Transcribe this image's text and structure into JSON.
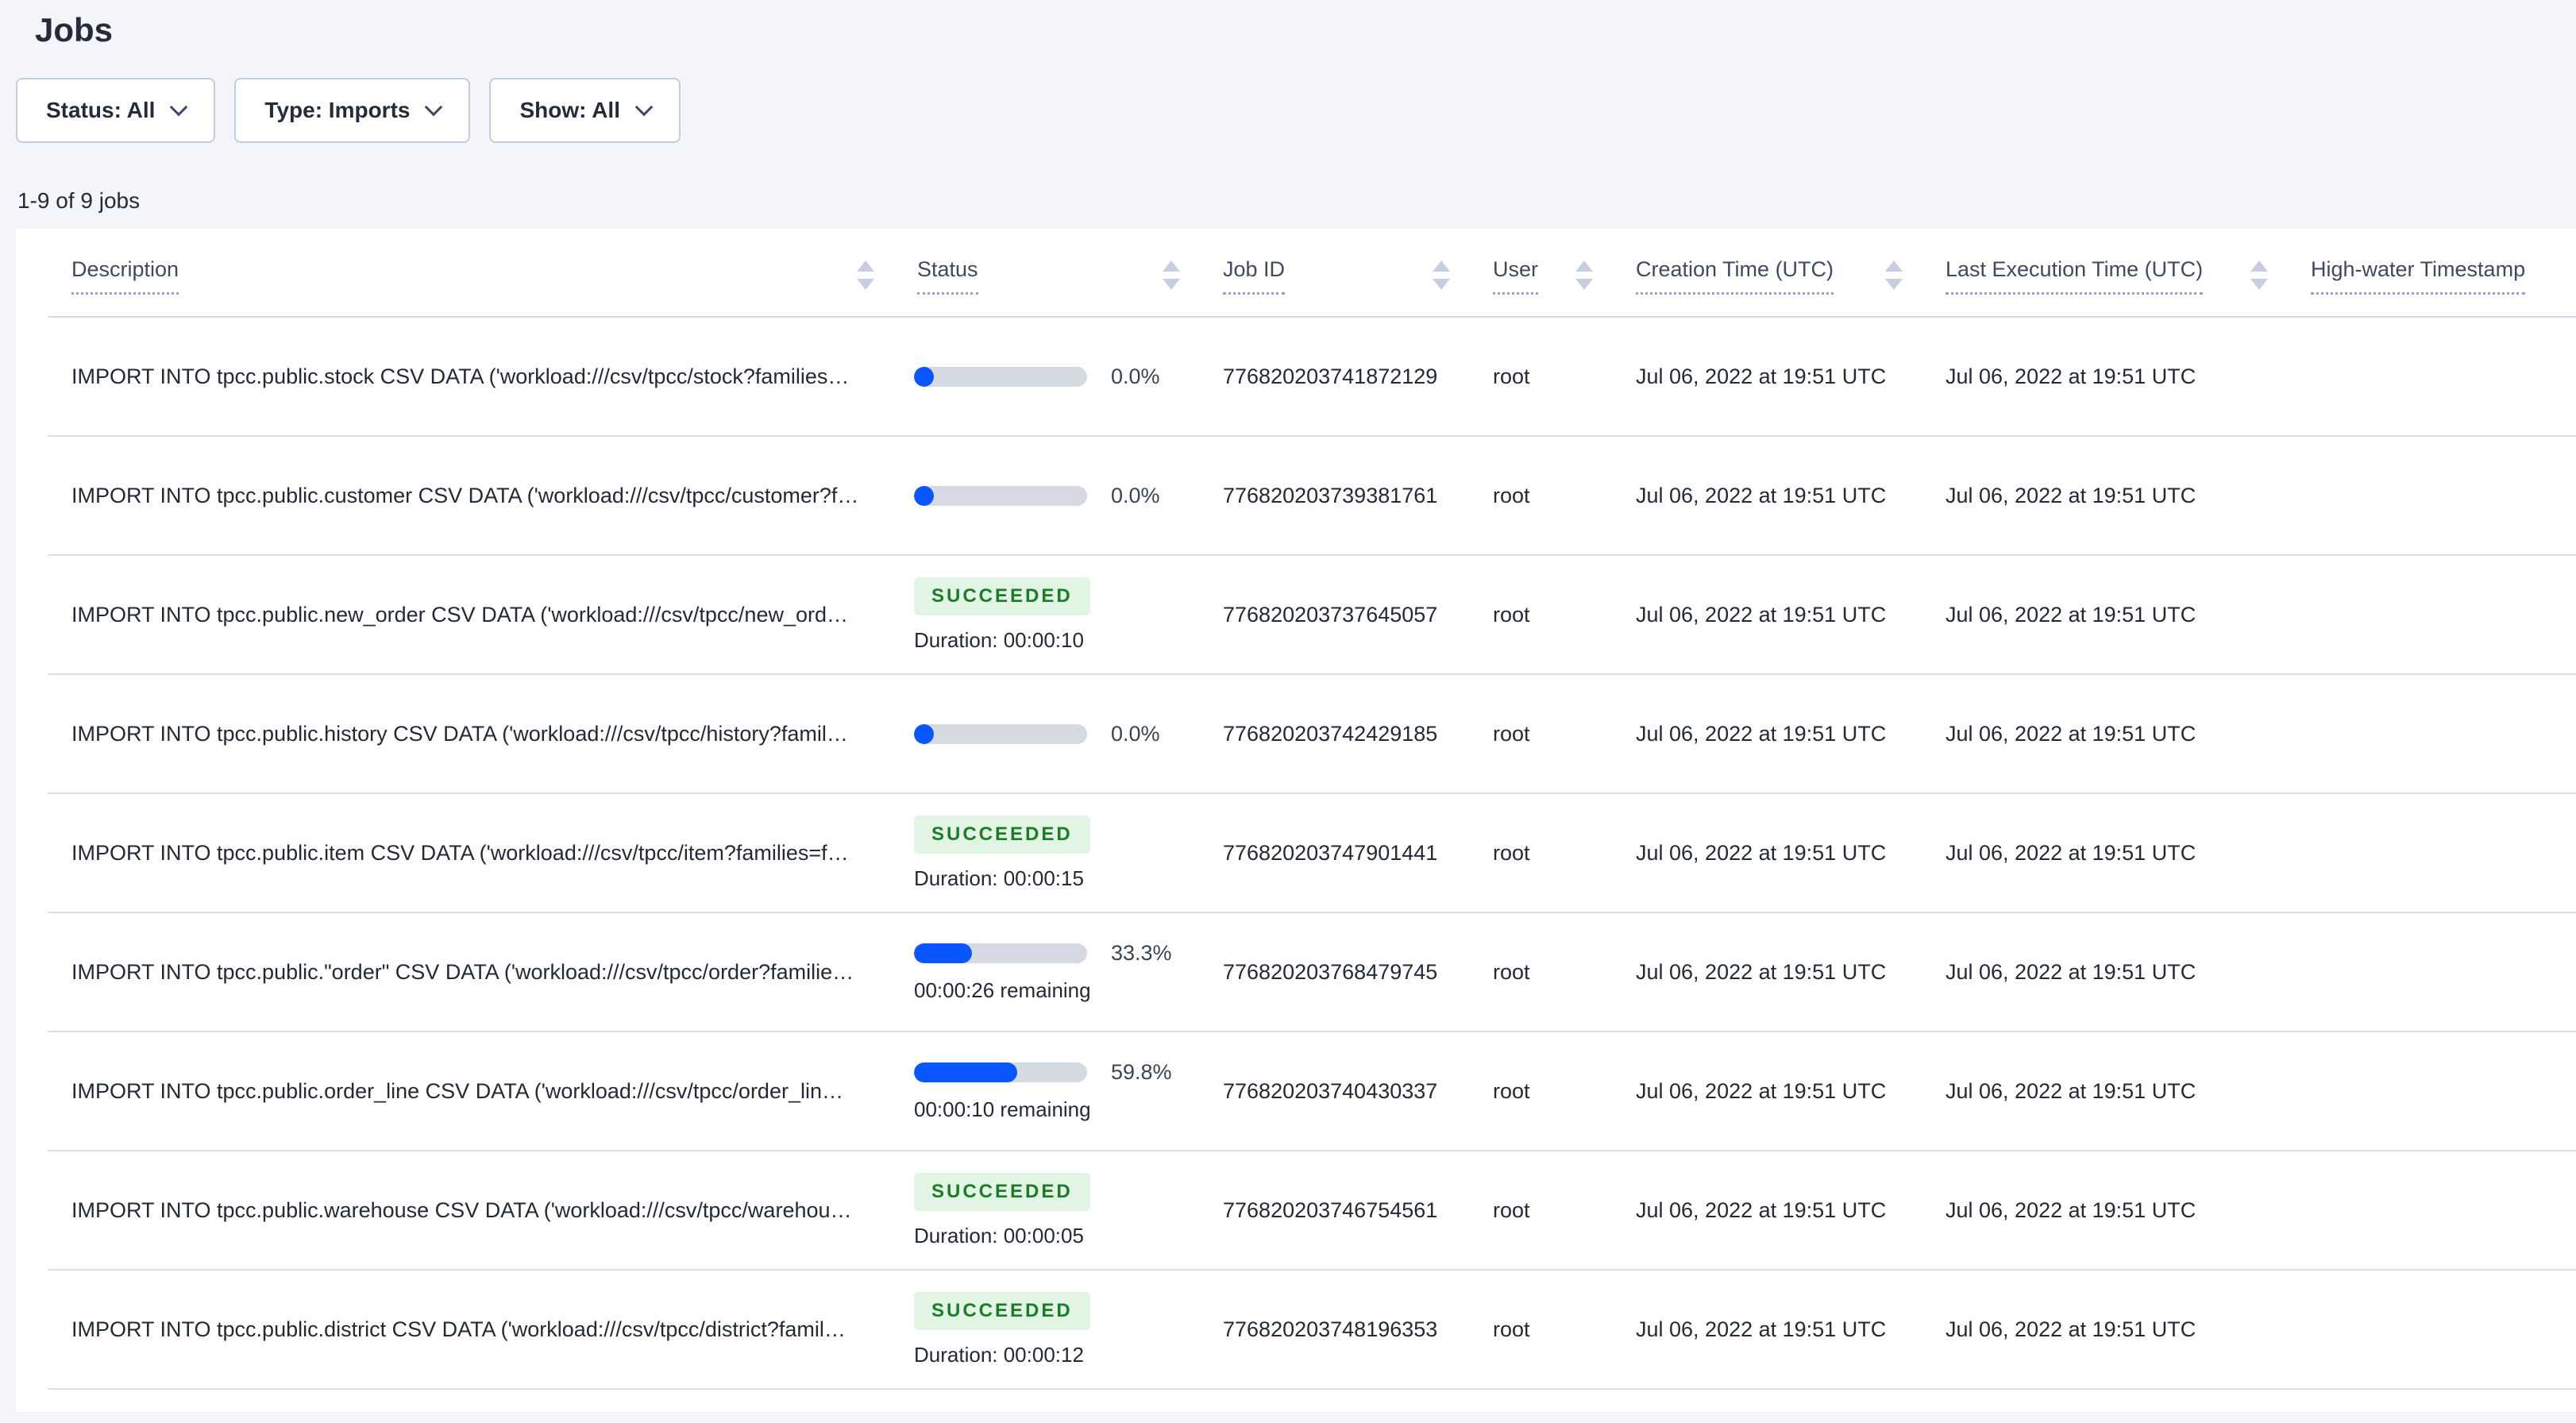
{
  "page": {
    "title": "Jobs"
  },
  "filters": [
    {
      "label": "Status: All"
    },
    {
      "label": "Type: Imports"
    },
    {
      "label": "Show: All"
    }
  ],
  "results_count": "1-9 of 9 jobs",
  "colors": {
    "accent_blue": "#0a57ff",
    "progress_track": "#d5d9e2",
    "success_badge_bg": "#e2f4e4",
    "success_badge_text": "#1d7c29"
  },
  "table": {
    "columns": [
      {
        "label": "Description",
        "sort": "none"
      },
      {
        "label": "Status",
        "sort": "none"
      },
      {
        "label": "Job ID",
        "sort": "none"
      },
      {
        "label": "User",
        "sort": "none"
      },
      {
        "label": "Creation Time (UTC)",
        "sort": "none"
      },
      {
        "label": "Last Execution Time (UTC)",
        "sort": "none"
      },
      {
        "label": "High-water Timestamp",
        "sort": "desc"
      }
    ],
    "rows": [
      {
        "description": "IMPORT INTO tpcc.public.stock CSV DATA ('workload:///csv/tpcc/stock?families…",
        "status": {
          "kind": "progress",
          "percent": 0,
          "percent_label": "0.0%"
        },
        "job_id": "776820203741872129",
        "user": "root",
        "creation_time": "Jul 06, 2022 at 19:51 UTC",
        "last_execution_time": "Jul 06, 2022 at 19:51 UTC",
        "high_water_timestamp": ""
      },
      {
        "description": "IMPORT INTO tpcc.public.customer CSV DATA ('workload:///csv/tpcc/customer?f…",
        "status": {
          "kind": "progress",
          "percent": 0,
          "percent_label": "0.0%"
        },
        "job_id": "776820203739381761",
        "user": "root",
        "creation_time": "Jul 06, 2022 at 19:51 UTC",
        "last_execution_time": "Jul 06, 2022 at 19:51 UTC",
        "high_water_timestamp": ""
      },
      {
        "description": "IMPORT INTO tpcc.public.new_order CSV DATA ('workload:///csv/tpcc/new_ord…",
        "status": {
          "kind": "succeeded",
          "badge": "SUCCEEDED",
          "sub": "Duration: 00:00:10"
        },
        "job_id": "776820203737645057",
        "user": "root",
        "creation_time": "Jul 06, 2022 at 19:51 UTC",
        "last_execution_time": "Jul 06, 2022 at 19:51 UTC",
        "high_water_timestamp": ""
      },
      {
        "description": "IMPORT INTO tpcc.public.history CSV DATA ('workload:///csv/tpcc/history?famil…",
        "status": {
          "kind": "progress",
          "percent": 0,
          "percent_label": "0.0%"
        },
        "job_id": "776820203742429185",
        "user": "root",
        "creation_time": "Jul 06, 2022 at 19:51 UTC",
        "last_execution_time": "Jul 06, 2022 at 19:51 UTC",
        "high_water_timestamp": ""
      },
      {
        "description": "IMPORT INTO tpcc.public.item CSV DATA ('workload:///csv/tpcc/item?families=f…",
        "status": {
          "kind": "succeeded",
          "badge": "SUCCEEDED",
          "sub": "Duration: 00:00:15"
        },
        "job_id": "776820203747901441",
        "user": "root",
        "creation_time": "Jul 06, 2022 at 19:51 UTC",
        "last_execution_time": "Jul 06, 2022 at 19:51 UTC",
        "high_water_timestamp": ""
      },
      {
        "description": "IMPORT INTO tpcc.public.\"order\" CSV DATA ('workload:///csv/tpcc/order?familie…",
        "status": {
          "kind": "progress",
          "percent": 33.3,
          "percent_label": "33.3%",
          "sub": "00:00:26 remaining"
        },
        "job_id": "776820203768479745",
        "user": "root",
        "creation_time": "Jul 06, 2022 at 19:51 UTC",
        "last_execution_time": "Jul 06, 2022 at 19:51 UTC",
        "high_water_timestamp": ""
      },
      {
        "description": "IMPORT INTO tpcc.public.order_line CSV DATA ('workload:///csv/tpcc/order_lin…",
        "status": {
          "kind": "progress",
          "percent": 59.8,
          "percent_label": "59.8%",
          "sub": "00:00:10 remaining"
        },
        "job_id": "776820203740430337",
        "user": "root",
        "creation_time": "Jul 06, 2022 at 19:51 UTC",
        "last_execution_time": "Jul 06, 2022 at 19:51 UTC",
        "high_water_timestamp": ""
      },
      {
        "description": "IMPORT INTO tpcc.public.warehouse CSV DATA ('workload:///csv/tpcc/warehou…",
        "status": {
          "kind": "succeeded",
          "badge": "SUCCEEDED",
          "sub": "Duration: 00:00:05"
        },
        "job_id": "776820203746754561",
        "user": "root",
        "creation_time": "Jul 06, 2022 at 19:51 UTC",
        "last_execution_time": "Jul 06, 2022 at 19:51 UTC",
        "high_water_timestamp": ""
      },
      {
        "description": "IMPORT INTO tpcc.public.district CSV DATA ('workload:///csv/tpcc/district?famil…",
        "status": {
          "kind": "succeeded",
          "badge": "SUCCEEDED",
          "sub": "Duration: 00:00:12"
        },
        "job_id": "776820203748196353",
        "user": "root",
        "creation_time": "Jul 06, 2022 at 19:51 UTC",
        "last_execution_time": "Jul 06, 2022 at 19:51 UTC",
        "high_water_timestamp": ""
      }
    ]
  }
}
